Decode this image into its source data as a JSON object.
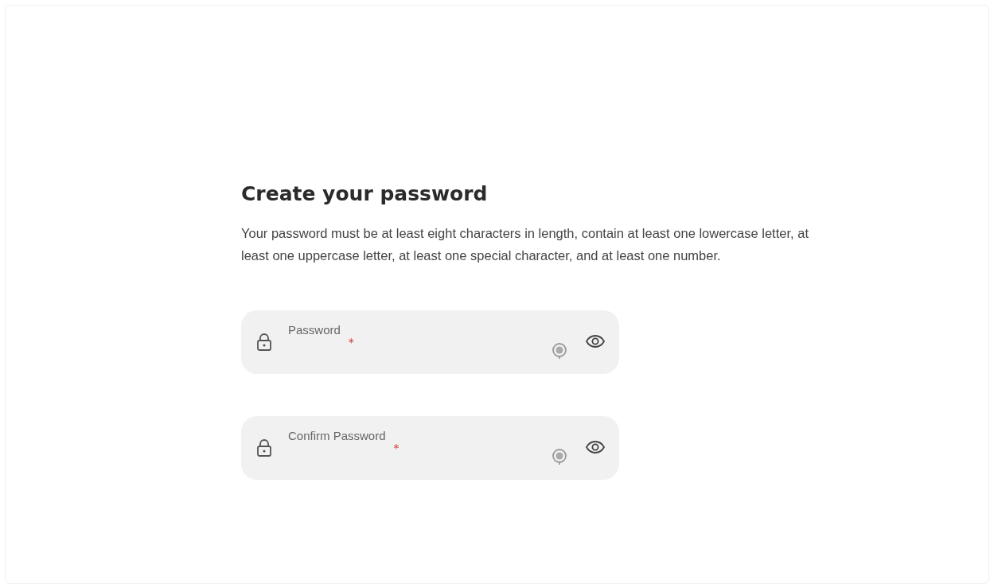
{
  "heading": "Create your password",
  "description": "Your password must be at least eight characters in length, contain at least one lowercase letter, at least one uppercase letter, at least one special character, and at least one number.",
  "fields": [
    {
      "label": "Password",
      "required_mark": "*"
    },
    {
      "label": "Confirm Password",
      "required_mark": "*"
    }
  ]
}
